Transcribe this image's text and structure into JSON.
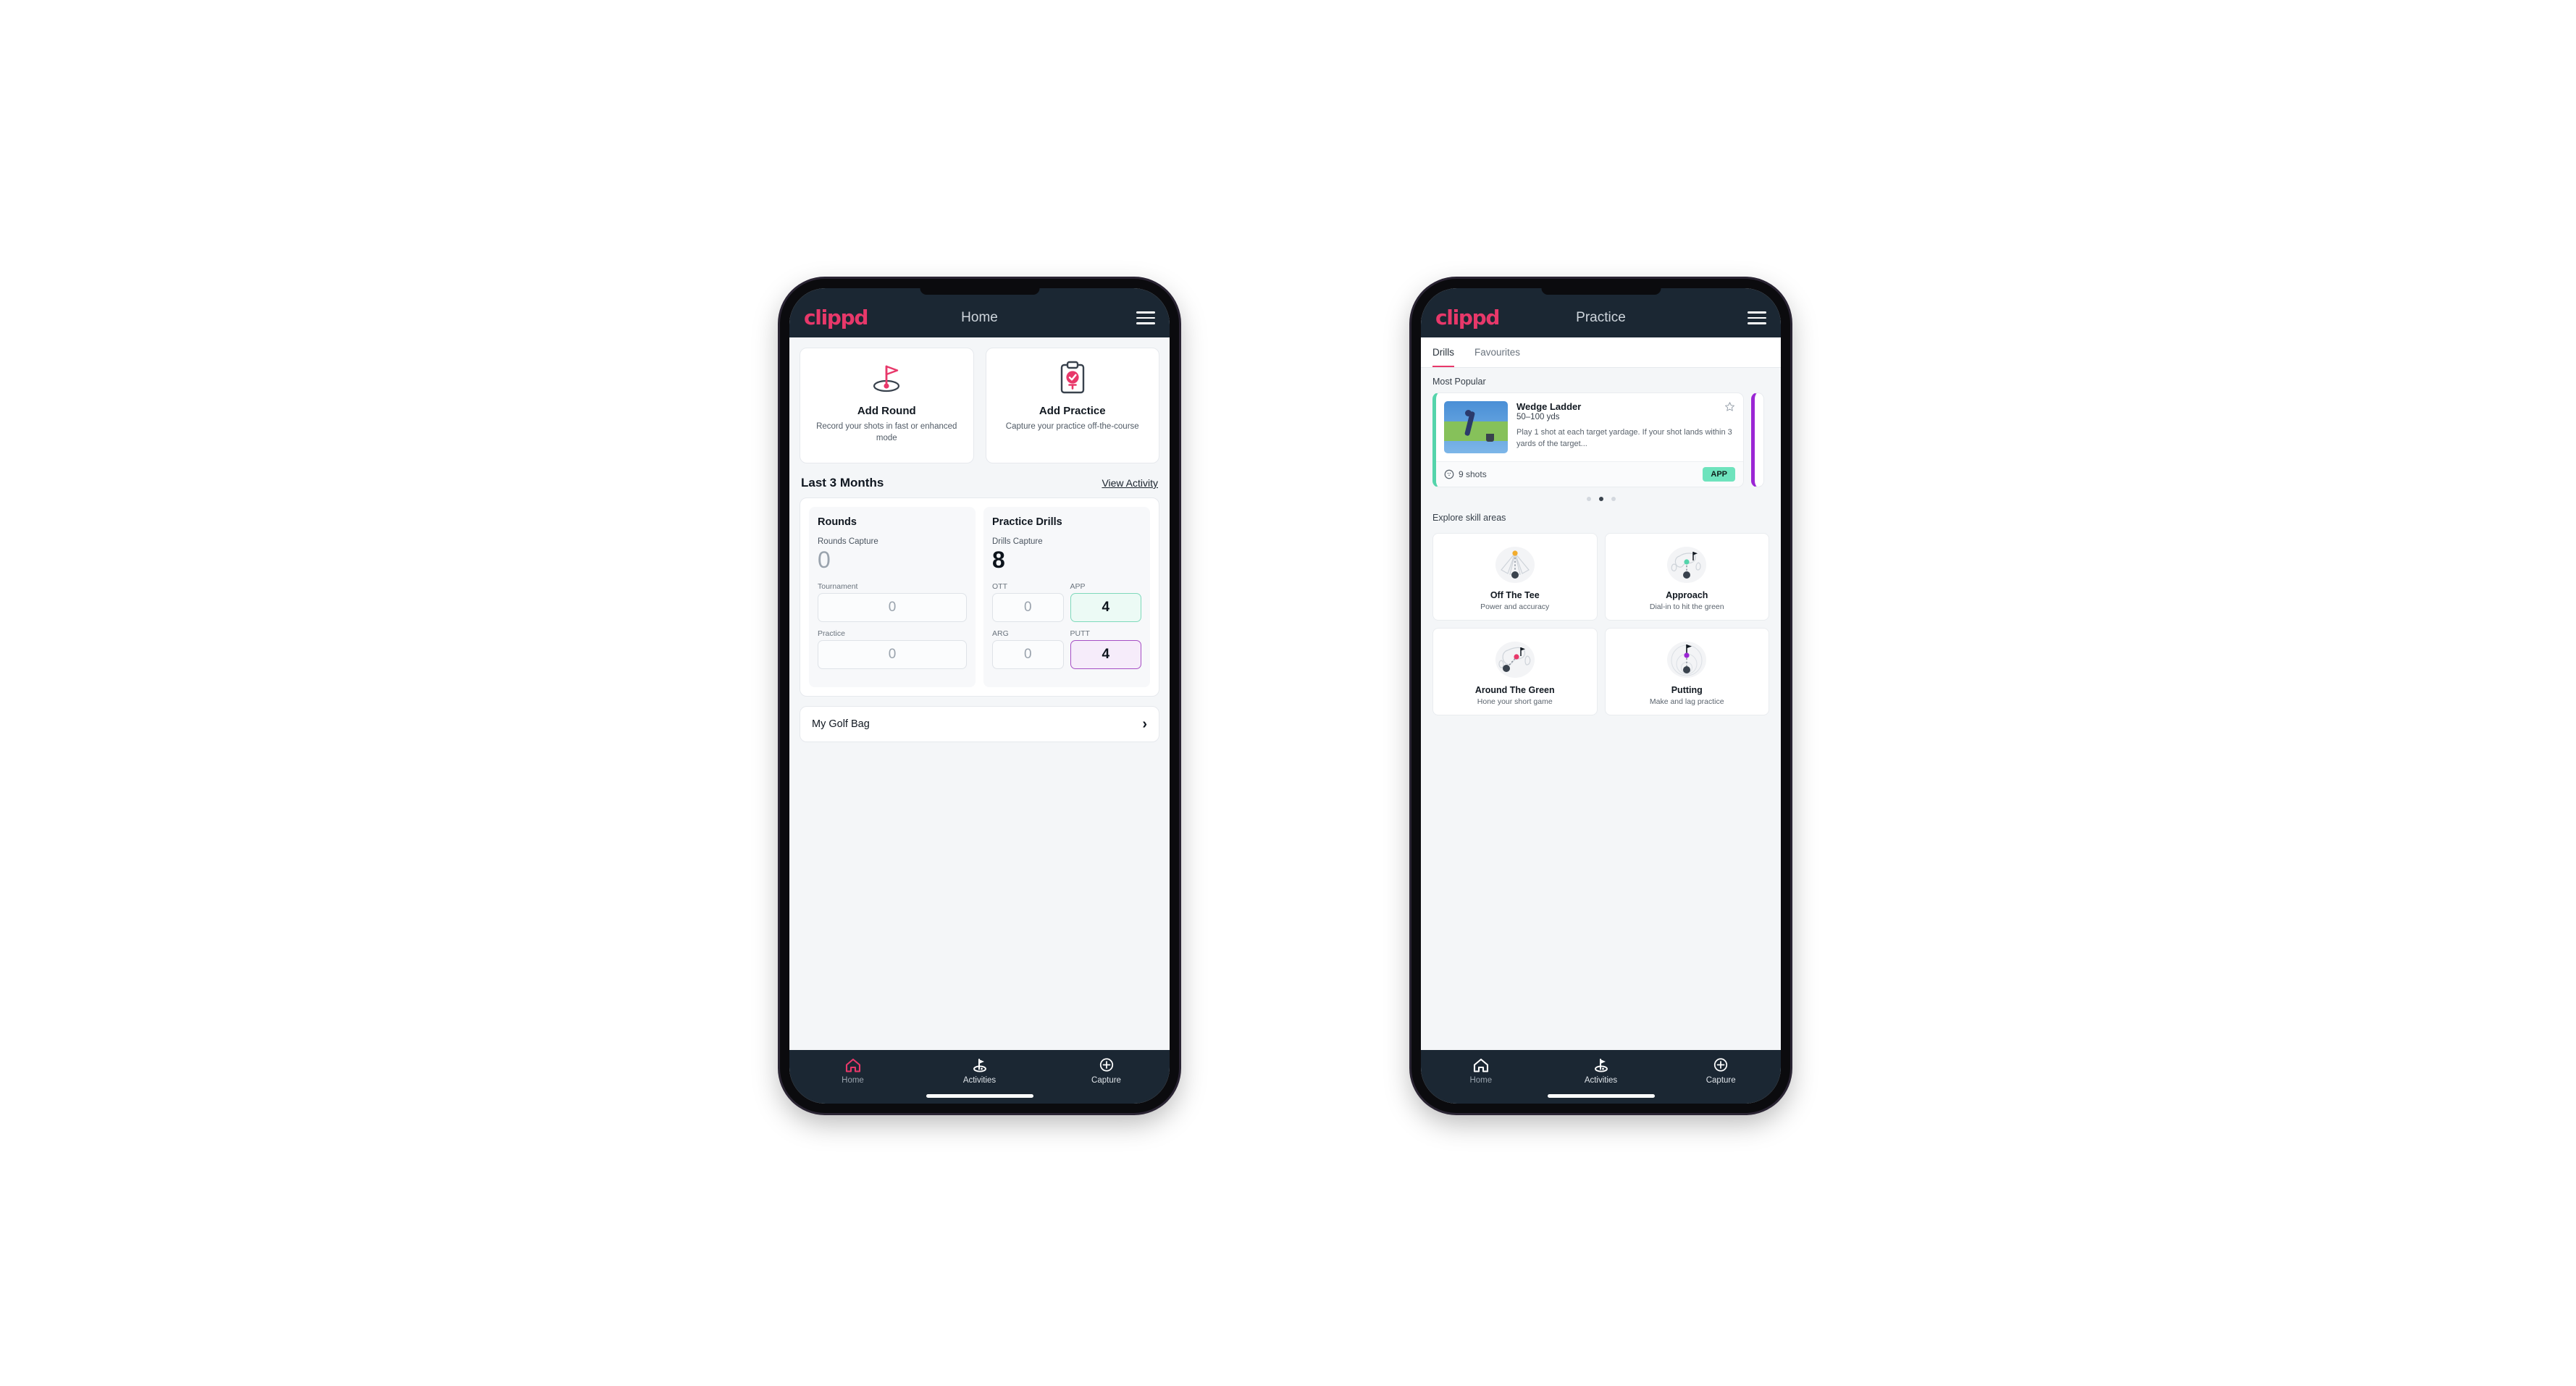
{
  "phone_home": {
    "appbar": {
      "brand": "clippd",
      "title": "Home",
      "menu_icon": "hamburger-icon"
    },
    "quick_actions": [
      {
        "icon": "golf-flag-hole-icon",
        "title": "Add Round",
        "subtitle": "Record your shots in fast or enhanced mode"
      },
      {
        "icon": "clipboard-check-icon",
        "title": "Add Practice",
        "subtitle": "Capture your practice off-the-course"
      }
    ],
    "section": {
      "title": "Last 3 Months",
      "link": "View Activity"
    },
    "stats": {
      "rounds": {
        "heading": "Rounds",
        "capture_label": "Rounds Capture",
        "capture_value": "0",
        "items": [
          {
            "label": "Tournament",
            "value": "0",
            "highlight": "none"
          },
          {
            "label": "Practice",
            "value": "0",
            "highlight": "none"
          }
        ]
      },
      "drills": {
        "heading": "Practice Drills",
        "capture_label": "Drills Capture",
        "capture_value": "8",
        "items": [
          {
            "label": "OTT",
            "value": "0",
            "highlight": "none"
          },
          {
            "label": "APP",
            "value": "4",
            "highlight": "green"
          },
          {
            "label": "ARG",
            "value": "0",
            "highlight": "none"
          },
          {
            "label": "PUTT",
            "value": "4",
            "highlight": "purple"
          }
        ]
      }
    },
    "golf_bag": {
      "label": "My Golf Bag",
      "chevron": "chevron-right-icon"
    },
    "bottom_nav": [
      {
        "icon": "home-icon",
        "label": "Home",
        "active": true
      },
      {
        "icon": "golf-flag-icon",
        "label": "Activities",
        "active": false
      },
      {
        "icon": "plus-circle-icon",
        "label": "Capture",
        "active": false
      }
    ]
  },
  "phone_practice": {
    "appbar": {
      "brand": "clippd",
      "title": "Practice",
      "menu_icon": "hamburger-icon"
    },
    "tabs": [
      {
        "label": "Drills",
        "active": true
      },
      {
        "label": "Favourites",
        "active": false
      }
    ],
    "most_popular_label": "Most Popular",
    "drill": {
      "title": "Wedge Ladder",
      "yardage": "50–100 yds",
      "description": "Play 1 shot at each target yardage. If your shot lands within 3 yards of the target...",
      "shots": "9 shots",
      "badge": "APP",
      "favourite_icon": "star-outline-icon",
      "shots_icon": "golf-ball-icon",
      "accent_color": "#54d4ab",
      "peek_accent_color": "#9b26d4"
    },
    "carousel_dots": {
      "count": 3,
      "active_index": 1
    },
    "skill_label": "Explore skill areas",
    "skills": [
      {
        "icon": "off-the-tee-icon",
        "title": "Off The Tee",
        "subtitle": "Power and accuracy",
        "accent": "#f2ac2c"
      },
      {
        "icon": "approach-icon",
        "title": "Approach",
        "subtitle": "Dial-in to hit the green",
        "accent": "#54d4ab"
      },
      {
        "icon": "around-the-green-icon",
        "title": "Around The Green",
        "subtitle": "Hone your short game",
        "accent": "#e8386a"
      },
      {
        "icon": "putting-icon",
        "title": "Putting",
        "subtitle": "Make and lag practice",
        "accent": "#9b26d4"
      }
    ],
    "bottom_nav": [
      {
        "icon": "home-icon",
        "label": "Home",
        "active": false
      },
      {
        "icon": "golf-flag-icon",
        "label": "Activities",
        "active": true
      },
      {
        "icon": "plus-circle-icon",
        "label": "Capture",
        "active": false
      }
    ]
  },
  "theme": {
    "brand_pink": "#e8386a",
    "appbar_bg": "#1b2733",
    "page_bg": "#f4f6f8",
    "green": "#54d4ab",
    "purple": "#9b26d4"
  }
}
